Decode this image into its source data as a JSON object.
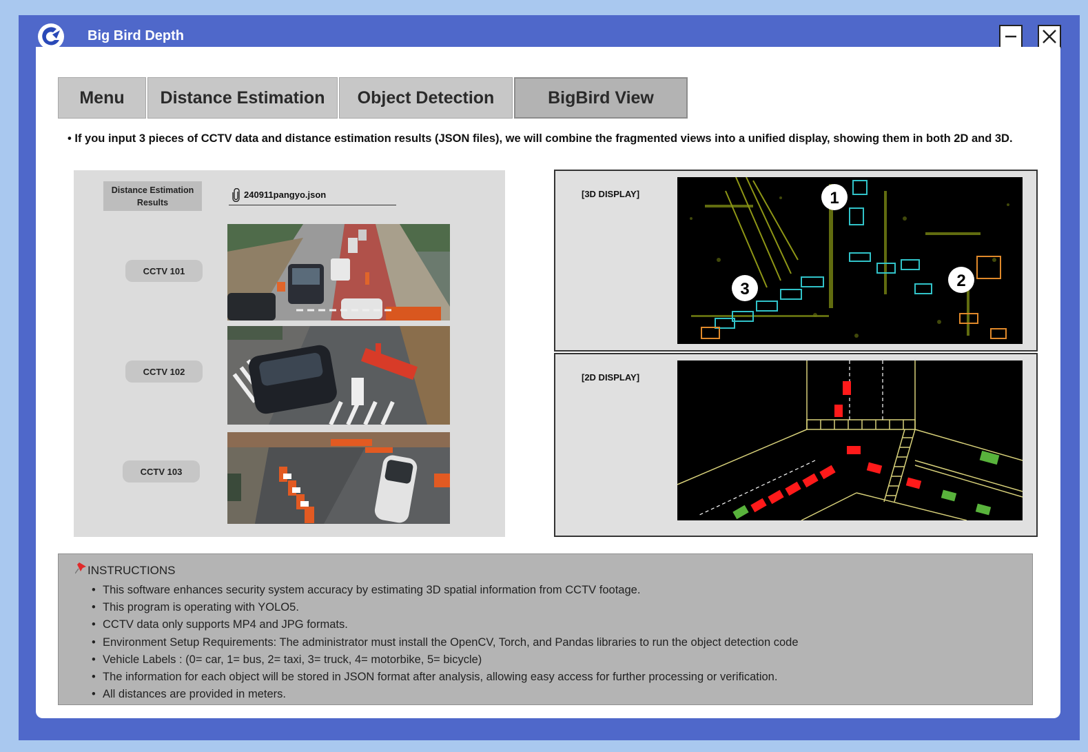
{
  "window": {
    "title": "Big Bird Depth",
    "minimize_icon": "minimize-icon",
    "close_icon": "close-icon",
    "accent_color": "#4f68ca"
  },
  "tabs": [
    {
      "label": "Menu"
    },
    {
      "label": "Distance Estimation"
    },
    {
      "label": "Object Detection"
    },
    {
      "label": "BigBird View",
      "active": true
    }
  ],
  "description": "If you input 3 pieces of CCTV data and distance estimation results (JSON files), we will combine the fragmented views into a unified display, showing them in both 2D and 3D.",
  "inputs": {
    "results_label": "Distance Estimation Results",
    "file_name": "240911pangyo.json",
    "cctv": [
      {
        "label": "CCTV 101"
      },
      {
        "label": "CCTV 102"
      },
      {
        "label": "CCTV 103"
      }
    ]
  },
  "displays": {
    "three_d_label": "[3D DISPLAY]",
    "two_d_label": "[2D DISPLAY]",
    "markers": [
      "1",
      "2",
      "3"
    ]
  },
  "instructions": {
    "title": "INSTRUCTIONS",
    "items": [
      "This software enhances security system accuracy by estimating 3D spatial information from CCTV footage.",
      "This program is operating with YOLO5.",
      "CCTV data only supports MP4 and JPG formats.",
      "Environment Setup Requirements: The administrator must install the OpenCV, Torch, and Pandas libraries to run the object detection code",
      "Vehicle Labels : (0= car, 1= bus, 2= taxi, 3= truck, 4= motorbike, 5= bicycle)",
      "The information for each object will be stored in JSON format after analysis, allowing easy access for further processing or verification.",
      "All distances are provided in meters."
    ]
  }
}
